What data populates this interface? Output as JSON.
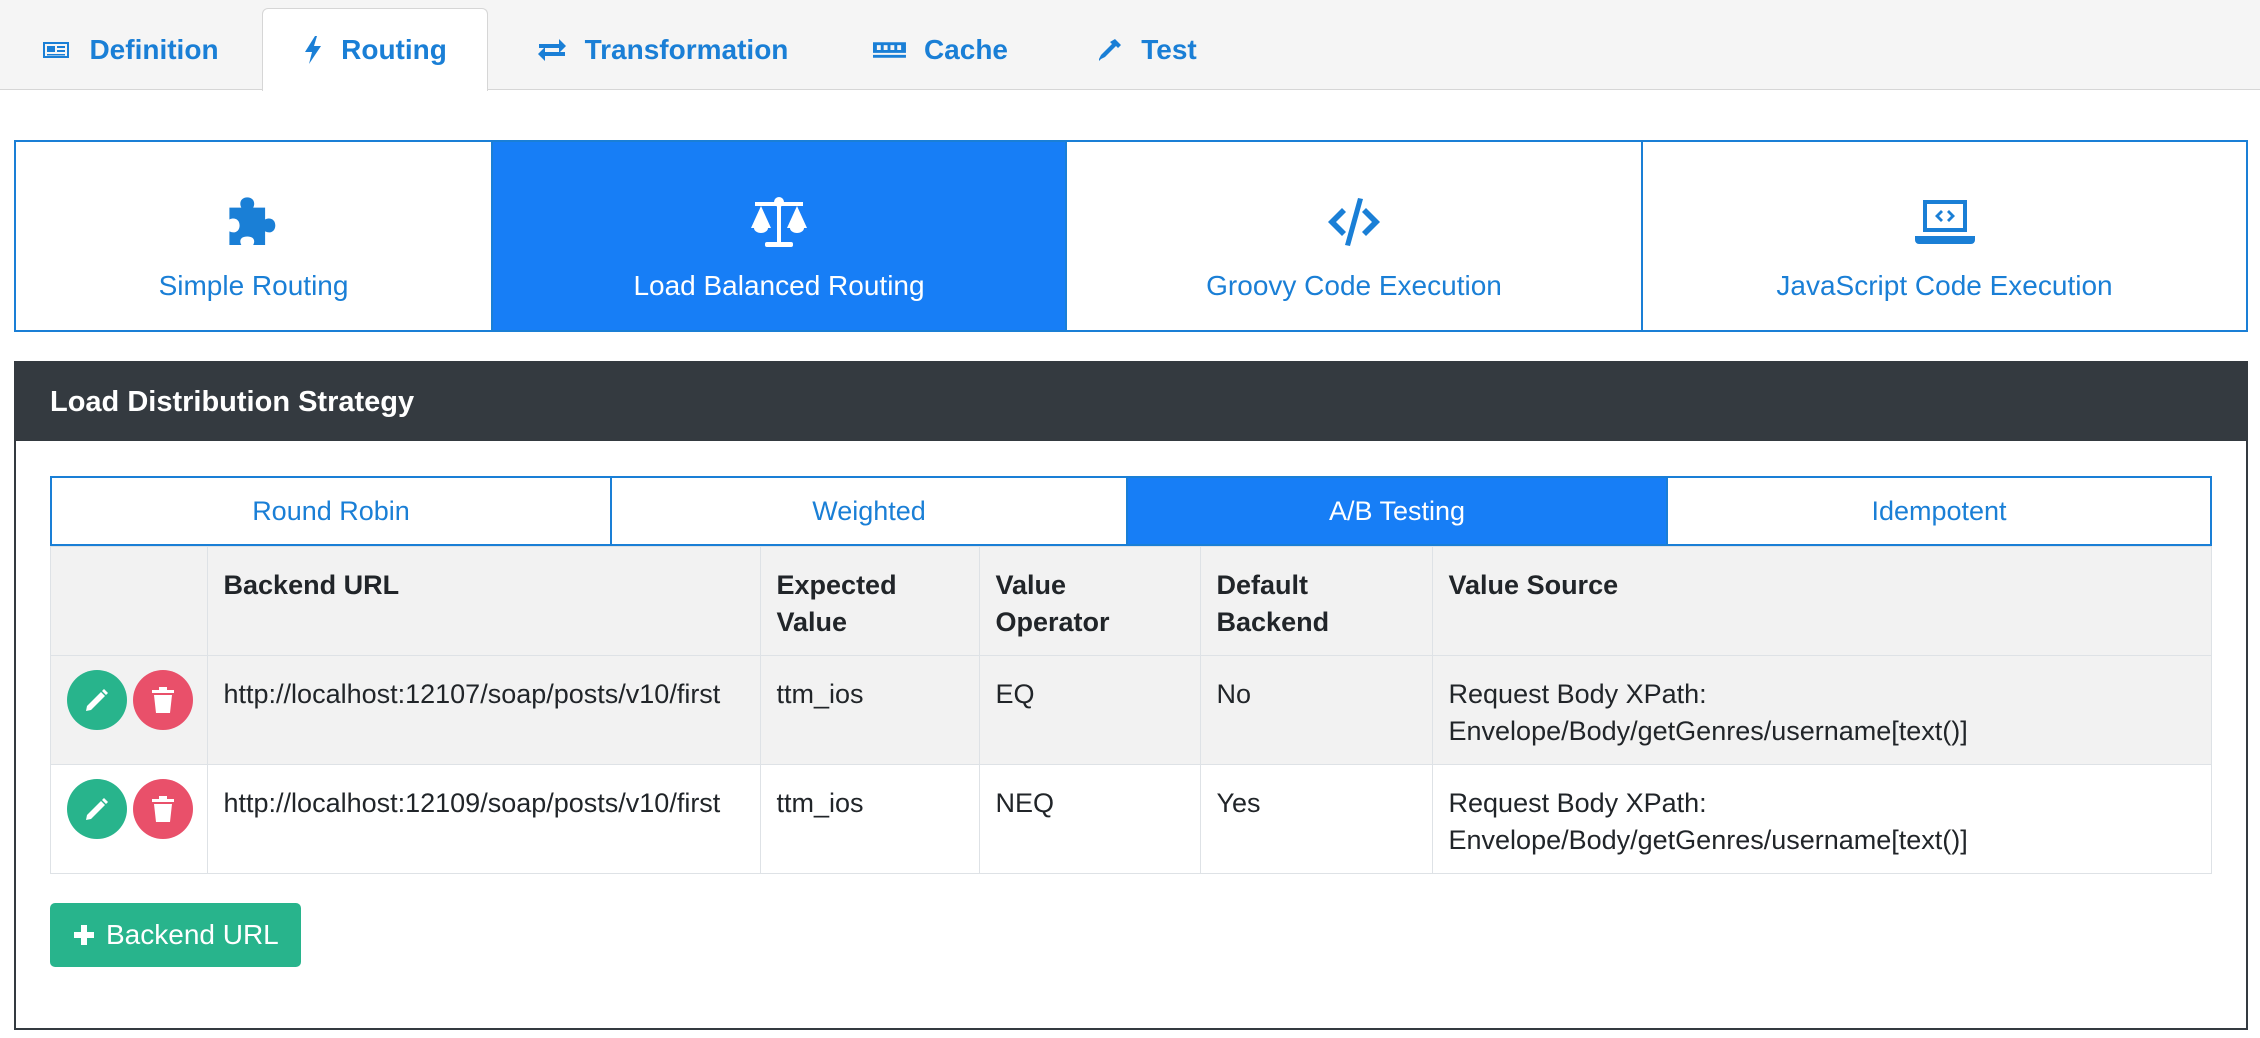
{
  "top_tabs": [
    {
      "label": "Definition",
      "icon": "newspaper-icon"
    },
    {
      "label": "Routing",
      "icon": "bolt-icon",
      "active": true
    },
    {
      "label": "Transformation",
      "icon": "exchange-icon"
    },
    {
      "label": "Cache",
      "icon": "memory-icon"
    },
    {
      "label": "Test",
      "icon": "eyedropper-icon"
    }
  ],
  "routing_types": [
    {
      "label": "Simple Routing",
      "icon": "puzzle-icon"
    },
    {
      "label": "Load Balanced Routing",
      "icon": "balance-scale-icon",
      "active": true
    },
    {
      "label": "Groovy Code Execution",
      "icon": "code-icon"
    },
    {
      "label": "JavaScript Code Execution",
      "icon": "laptop-code-icon"
    }
  ],
  "panel": {
    "title": "Load Distribution Strategy"
  },
  "strategy_tabs": [
    {
      "label": "Round Robin"
    },
    {
      "label": "Weighted"
    },
    {
      "label": "A/B Testing",
      "active": true
    },
    {
      "label": "Idempotent"
    }
  ],
  "table": {
    "headers": [
      "",
      "Backend URL",
      "Expected Value",
      "Value Operator",
      "Default Backend",
      "Value Source"
    ],
    "rows": [
      {
        "backend_url": "http://localhost:12107/soap/posts/v10/first",
        "expected_value": "ttm_ios",
        "value_operator": "EQ",
        "default_backend": "No",
        "value_source_line1": "Request Body XPath:",
        "value_source_line2": "Envelope/Body/getGenres/username[text()]"
      },
      {
        "backend_url": "http://localhost:12109/soap/posts/v10/first",
        "expected_value": "ttm_ios",
        "value_operator": "NEQ",
        "default_backend": "Yes",
        "value_source_line1": "Request Body XPath:",
        "value_source_line2": "Envelope/Body/getGenres/username[text()]"
      }
    ]
  },
  "add_button": {
    "label": "Backend URL",
    "icon": "plus-icon"
  },
  "colors": {
    "accent": "#177ef6",
    "link": "#1a7fd6",
    "panel_header": "#343a40",
    "edit": "#28b48c",
    "delete": "#e9506a"
  }
}
